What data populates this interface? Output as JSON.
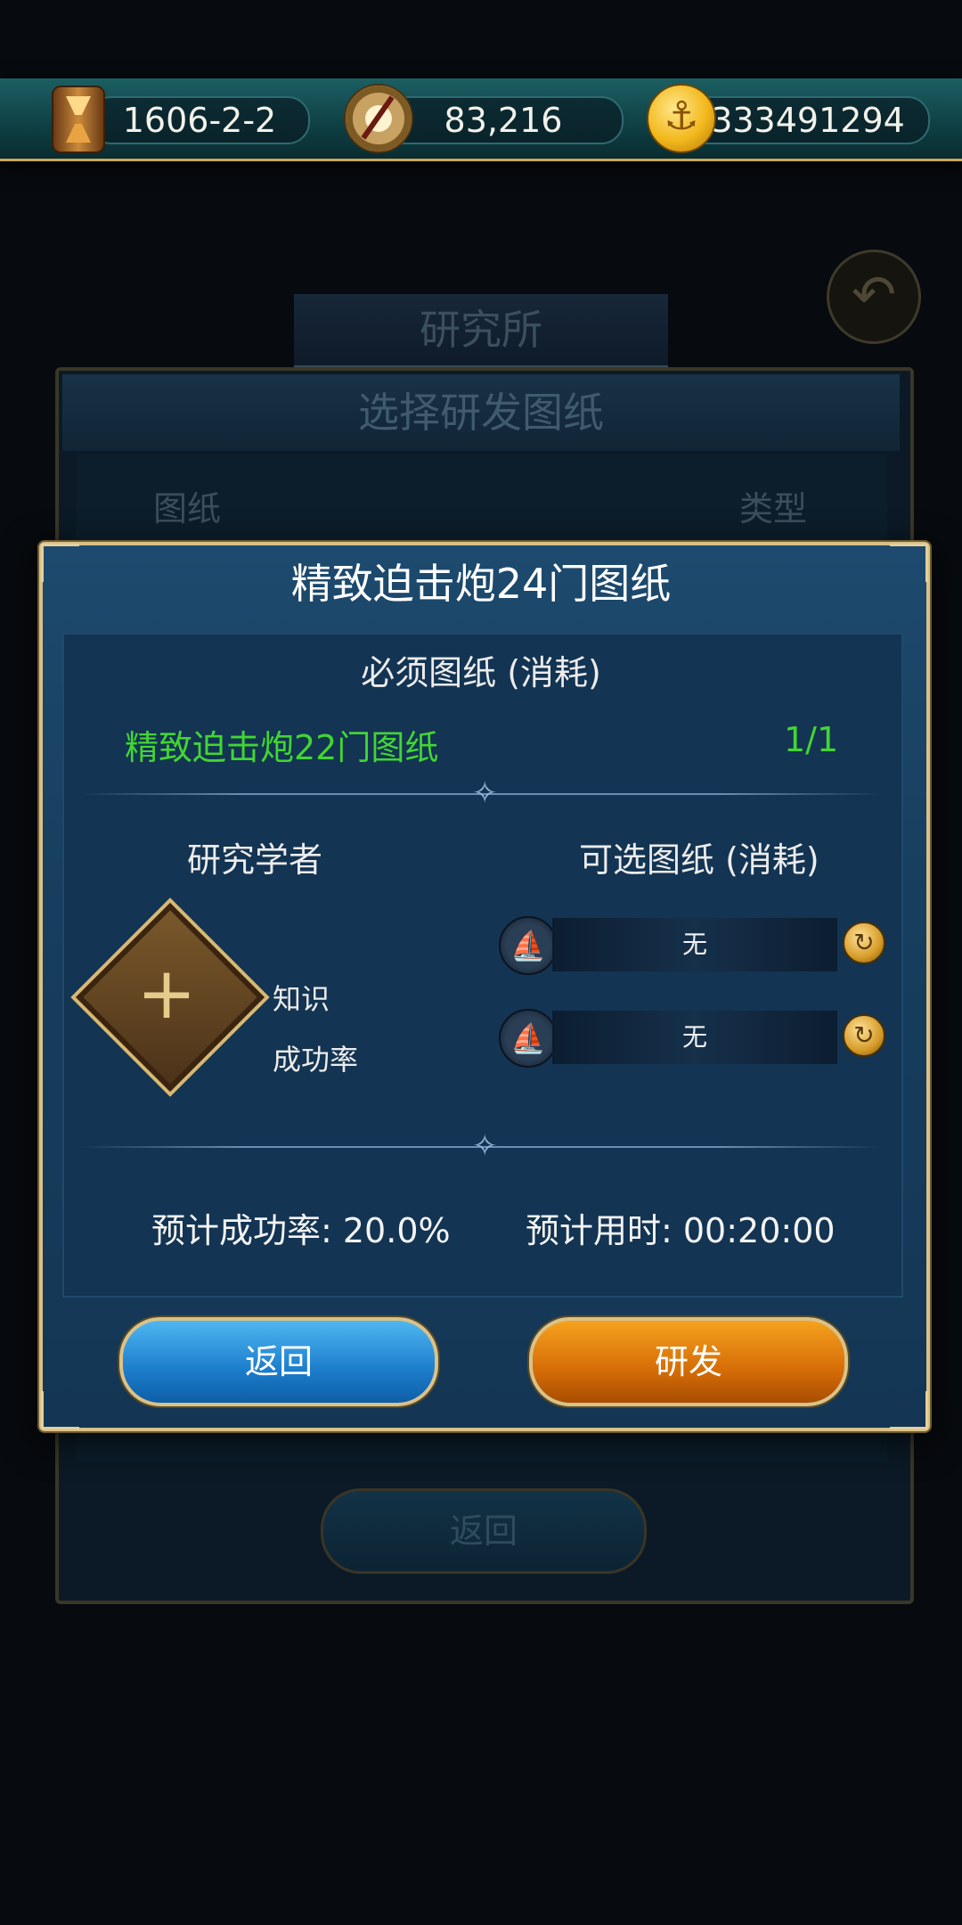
{
  "topbar": {
    "date": "1606-2-2",
    "exploration_points": "83,216",
    "gold": "333491294"
  },
  "background": {
    "location_title": "研究所",
    "panel_title": "选择研发图纸",
    "col_blueprint": "图纸",
    "col_type": "类型",
    "return_label": "返回"
  },
  "dialog": {
    "title": "精致迫击炮24门图纸",
    "required_heading": "必须图纸 (消耗)",
    "required_item": "精致迫击炮22门图纸",
    "required_count": "1/1",
    "scholar_heading": "研究学者",
    "optional_heading": "可选图纸 (消耗)",
    "knowledge_label": "知识",
    "success_label": "成功率",
    "optional_slots": [
      "无",
      "无"
    ],
    "estimated_rate": "预计成功率: 20.0%",
    "estimated_time": "预计用时: 00:20:00",
    "return_button": "返回",
    "research_button": "研发"
  },
  "colors": {
    "required_green": "#42d534",
    "return_blue": "#1c7dcc",
    "research_orange": "#d66d07",
    "frame_gold": "#d8c188"
  },
  "icons": [
    "hourglass-icon",
    "compass-icon",
    "gold-coin-icon",
    "back-arrow-icon",
    "plus-icon",
    "ship-icon",
    "refresh-icon"
  ]
}
